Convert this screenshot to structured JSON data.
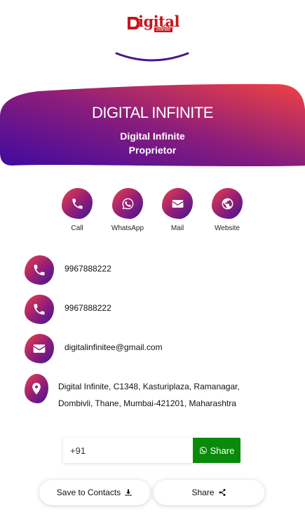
{
  "logo": {
    "text": "igital",
    "tagline": "infinite"
  },
  "banner": {
    "title": "DIGITAL INFINITE",
    "name": "Digital Infinite",
    "role": "Proprietor"
  },
  "actions": [
    {
      "label": "Call",
      "icon": "phone-icon"
    },
    {
      "label": "WhatsApp",
      "icon": "whatsapp-icon"
    },
    {
      "label": "Mail",
      "icon": "mail-icon"
    },
    {
      "label": "Website",
      "icon": "globe-icon"
    }
  ],
  "contacts": {
    "phone1": "9967888222",
    "phone2": "9967888222",
    "email": "digitalinfinitee@gmail.com",
    "address_line1": "Digital Infinite, C1348, Kasturiplaza, Ramanagar,",
    "address_line2": "Dombivli, Thane, Mumbai-421201, Maharashtra"
  },
  "share_form": {
    "phone_value": "+91",
    "share_label": "Share"
  },
  "buttons": {
    "save_contacts": "Save to Contacts",
    "share": "Share"
  },
  "colors": {
    "gradient_start": "#e8424a",
    "gradient_mid": "#9a1f74",
    "gradient_end": "#3f1596",
    "share_green": "#0a8a0a",
    "logo_red": "#c4161c"
  }
}
